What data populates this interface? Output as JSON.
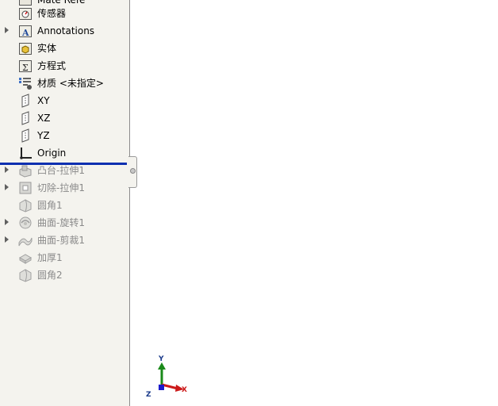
{
  "feature_tree": {
    "top_partial_label": "Mate Refe",
    "items": [
      {
        "label": "传感器",
        "icon": "sensor-folder-icon",
        "expandable": false,
        "suppressed": false
      },
      {
        "label": "Annotations",
        "icon": "annotations-folder-icon",
        "expandable": true,
        "suppressed": false
      },
      {
        "label": "实体",
        "icon": "solid-bodies-folder-icon",
        "expandable": false,
        "suppressed": false
      },
      {
        "label": "方程式",
        "icon": "equations-folder-icon",
        "expandable": false,
        "suppressed": false
      },
      {
        "label": "材质 <未指定>",
        "icon": "material-icon",
        "expandable": false,
        "suppressed": false
      },
      {
        "label": "XY",
        "icon": "plane-icon",
        "expandable": false,
        "suppressed": false
      },
      {
        "label": "XZ",
        "icon": "plane-icon",
        "expandable": false,
        "suppressed": false
      },
      {
        "label": "YZ",
        "icon": "plane-icon",
        "expandable": false,
        "suppressed": false
      },
      {
        "label": "Origin",
        "icon": "origin-icon",
        "expandable": false,
        "suppressed": false
      },
      {
        "label": "凸台-拉伸1",
        "icon": "boss-extrude-icon",
        "expandable": true,
        "suppressed": true
      },
      {
        "label": "切除-拉伸1",
        "icon": "cut-extrude-icon",
        "expandable": true,
        "suppressed": true
      },
      {
        "label": "圆角1",
        "icon": "fillet-icon",
        "expandable": false,
        "suppressed": true
      },
      {
        "label": "曲面-旋转1",
        "icon": "surface-revolve-icon",
        "expandable": true,
        "suppressed": true
      },
      {
        "label": "曲面-剪裁1",
        "icon": "surface-trim-icon",
        "expandable": true,
        "suppressed": true
      },
      {
        "label": "加厚1",
        "icon": "thicken-icon",
        "expandable": false,
        "suppressed": true
      },
      {
        "label": "圆角2",
        "icon": "fillet-icon",
        "expandable": false,
        "suppressed": true
      }
    ]
  },
  "triad": {
    "x_label": "X",
    "y_label": "Y",
    "z_label": "Z",
    "x_color": "#cc1a1a",
    "y_color": "#1a8a1a",
    "z_color": "#1a1acc"
  },
  "colors": {
    "rollback_bar": "#0c2fb0",
    "panel_bg": "#f4f3ee"
  }
}
